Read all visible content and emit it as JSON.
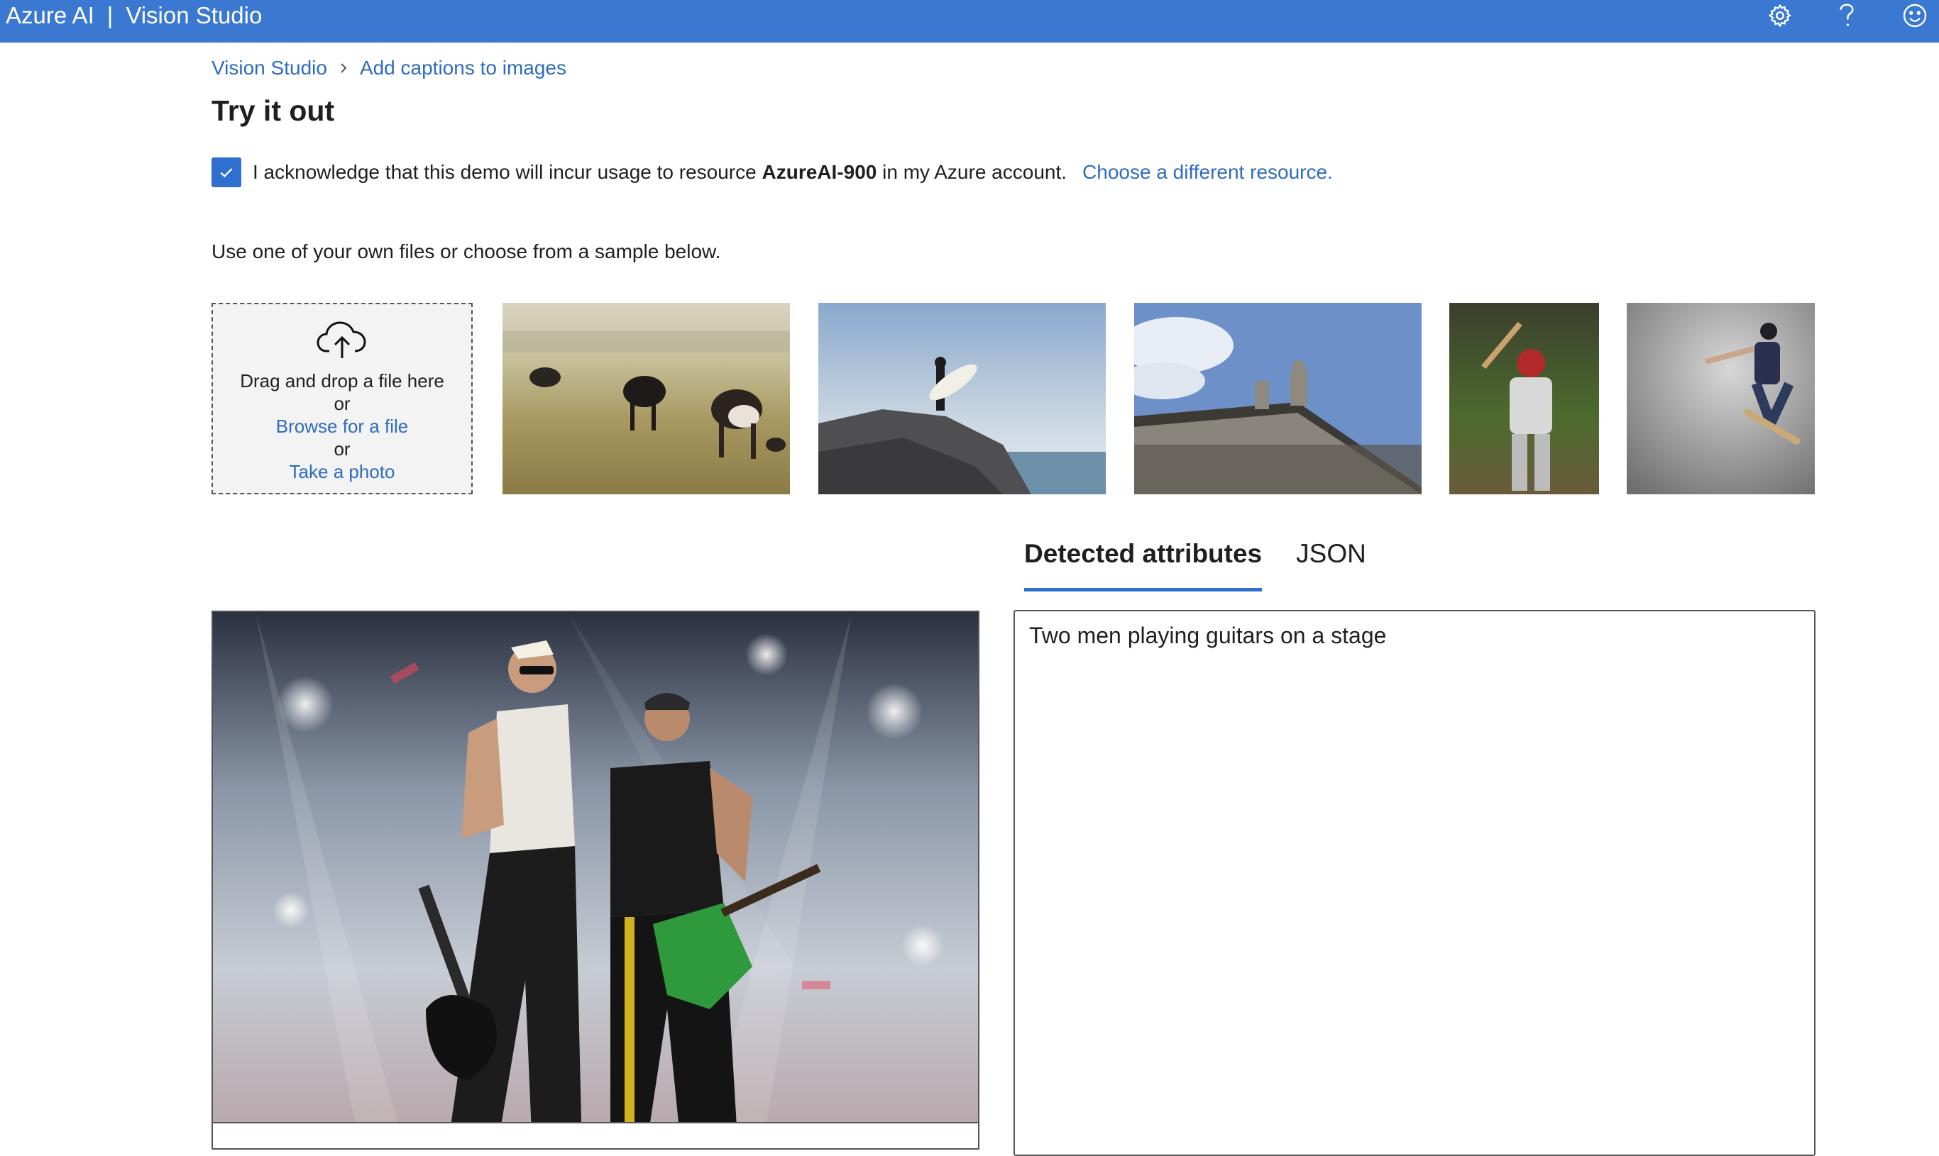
{
  "header": {
    "brand": "Azure AI",
    "separator": "|",
    "product": "Vision Studio",
    "icons": [
      "settings-icon",
      "help-icon",
      "feedback-smiley-icon"
    ]
  },
  "breadcrumb": {
    "home": "Vision Studio",
    "current": "Add captions to images"
  },
  "page": {
    "title": "Try it out"
  },
  "acknowledge": {
    "checked": true,
    "text_before": "I acknowledge that this demo will incur usage to resource ",
    "resource": "AzureAI-900",
    "text_after": " in my Azure account.",
    "change_link": "Choose a different resource."
  },
  "instructions": "Use one of your own files or choose from a sample below.",
  "upload": {
    "line1": "Drag and drop a file here",
    "or1": "or",
    "browse": "Browse for a file",
    "or2": "or",
    "photo": "Take a photo"
  },
  "samples": [
    {
      "subject": "cows grazing in a field"
    },
    {
      "subject": "surfer standing on a rock"
    },
    {
      "subject": "building rooftop with statues"
    },
    {
      "subject": "baseball batter"
    },
    {
      "subject": "skateboarder jumping"
    }
  ],
  "result": {
    "tabs": [
      {
        "label": "Detected attributes",
        "active": true
      },
      {
        "label": "JSON",
        "active": false
      }
    ],
    "caption": "Two men playing guitars on a stage"
  },
  "colors": {
    "header_bg": "#3a78d1",
    "link": "#2d6cc0",
    "accent": "#2f6fd0"
  }
}
